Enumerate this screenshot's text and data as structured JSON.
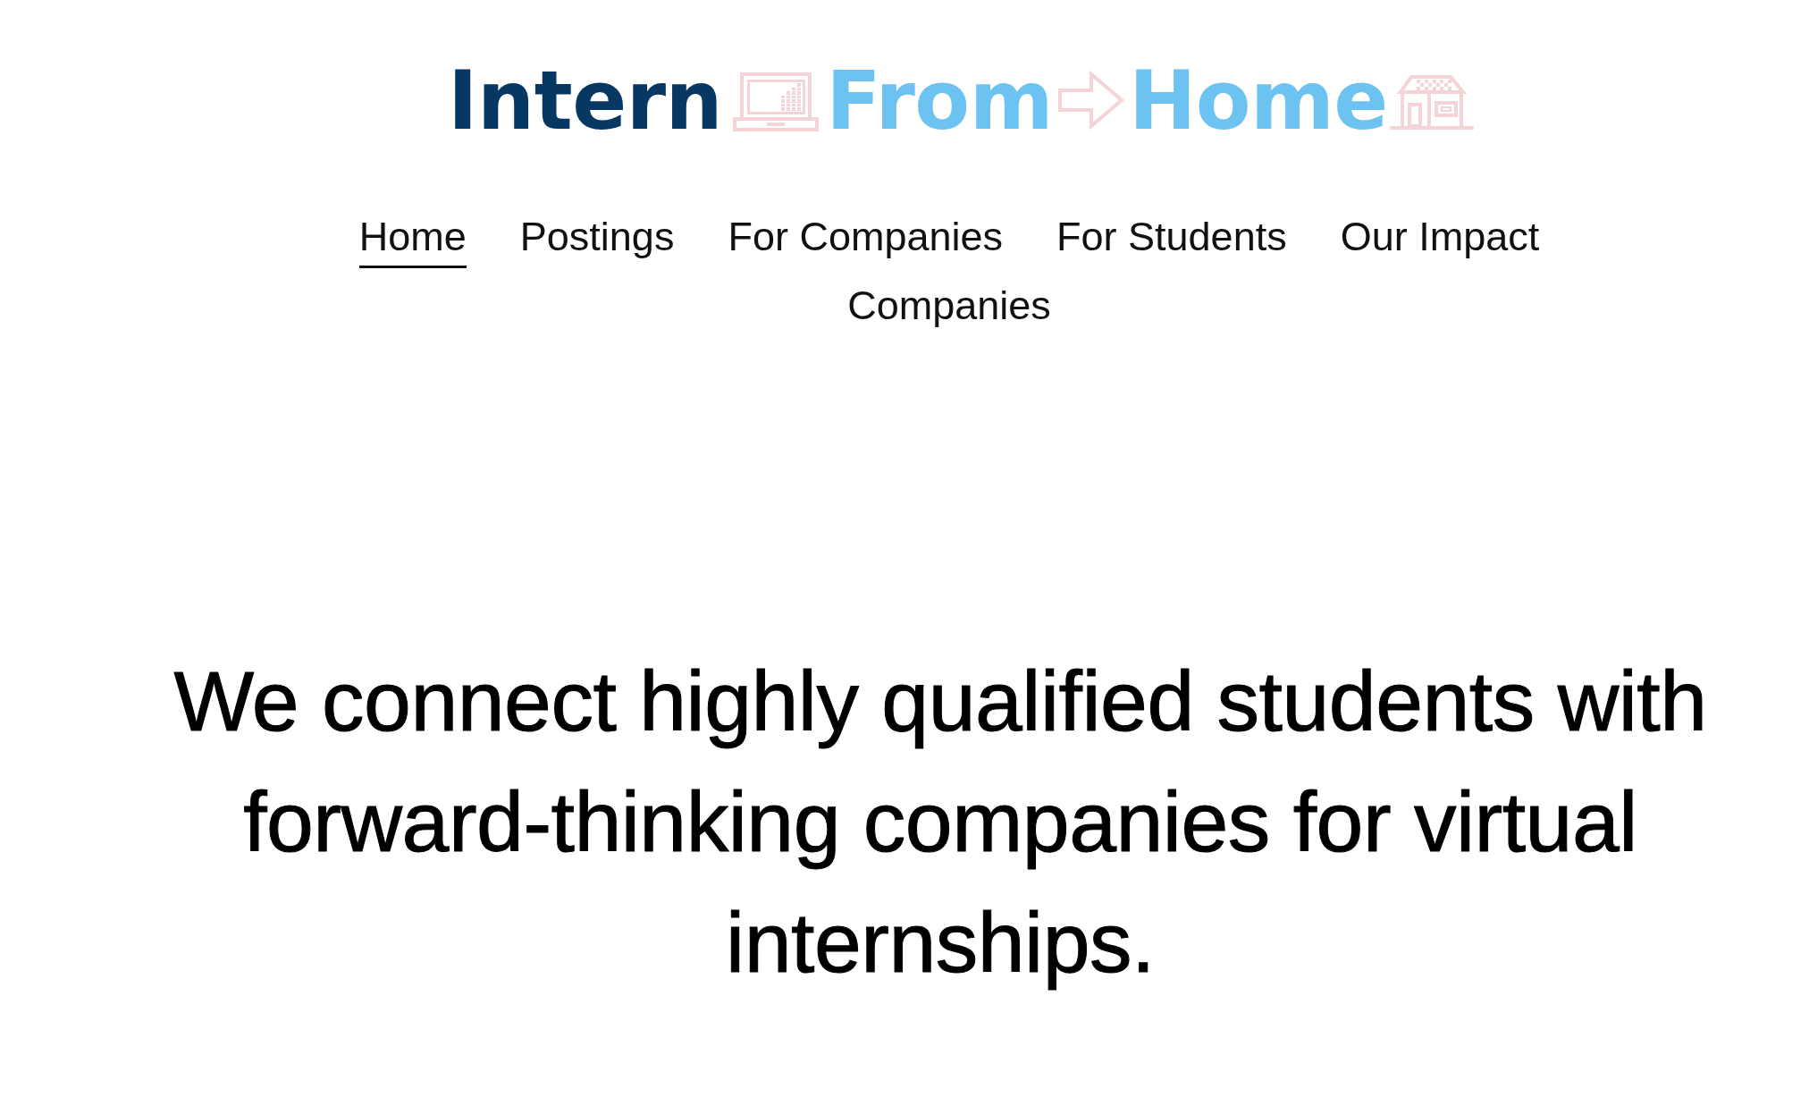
{
  "logo": {
    "words": [
      {
        "text": "Intern",
        "color": "#073763"
      },
      {
        "text": "From",
        "color": "#6cc3f1"
      },
      {
        "text": "Home",
        "color": "#6cc3f1"
      }
    ]
  },
  "nav": {
    "items": [
      {
        "label": "Home",
        "selected": true
      },
      {
        "label": "Postings",
        "selected": false
      },
      {
        "label": "For Companies",
        "selected": false
      },
      {
        "label": "For Students",
        "selected": false
      },
      {
        "label": "Our Impact",
        "selected": false
      },
      {
        "label": "Companies",
        "selected": false
      }
    ]
  },
  "headline": "We connect highly qualified students with forward-thinking companies for virtual internships."
}
